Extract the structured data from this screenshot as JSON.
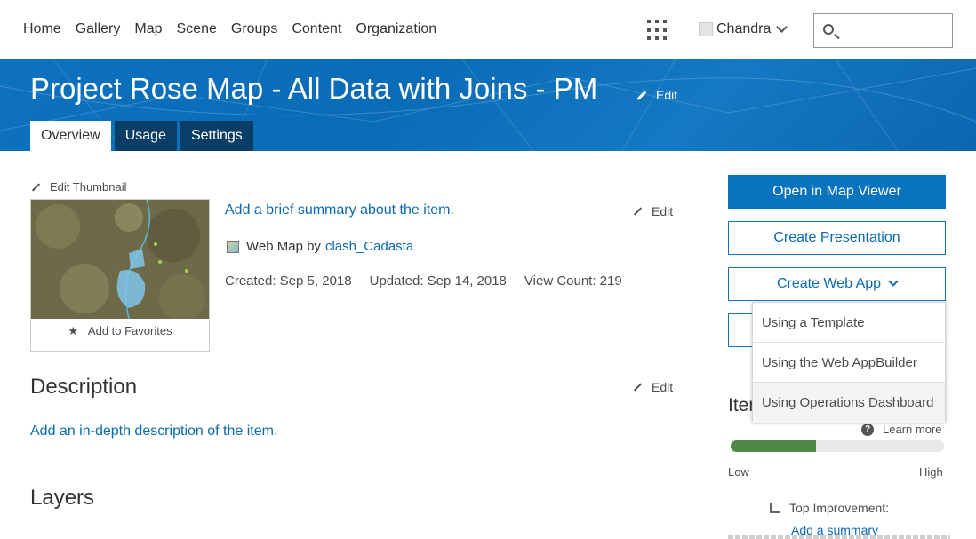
{
  "nav": {
    "links": [
      "Home",
      "Gallery",
      "Map",
      "Scene",
      "Groups",
      "Content",
      "Organization"
    ],
    "user_name": "Chandra",
    "search_placeholder": ""
  },
  "header": {
    "title": "Project Rose Map - All Data with Joins - PM",
    "edit_label": "Edit",
    "tabs": [
      {
        "label": "Overview",
        "active": true
      },
      {
        "label": "Usage",
        "active": false
      },
      {
        "label": "Settings",
        "active": false
      }
    ]
  },
  "item": {
    "edit_thumbnail_label": "Edit Thumbnail",
    "add_to_favorites_label": "Add to Favorites",
    "summary_link": "Add a brief summary about the item.",
    "summary_edit_label": "Edit",
    "type_label": "Web Map by",
    "owner": "clash_Cadasta",
    "created": "Created: Sep 5, 2018",
    "updated": "Updated: Sep 14, 2018",
    "view_count": "View Count: 219"
  },
  "description": {
    "heading": "Description",
    "edit_label": "Edit",
    "link": "Add an in-depth description of the item."
  },
  "layers": {
    "heading": "Layers"
  },
  "sidebar": {
    "open_map_viewer": "Open in Map Viewer",
    "create_presentation": "Create Presentation",
    "create_web_app": "Create Web App",
    "dropdown_items": [
      "Using a Template",
      "Using the Web AppBuilder",
      "Using Operations Dashboard"
    ],
    "details_heading_partial": "Item",
    "learn_more": "Learn more",
    "quality_score_fraction": 0.4,
    "low_label": "Low",
    "high_label": "High",
    "top_improvement_label": "Top Improvement:",
    "add_summary_link": "Add a summary"
  },
  "colors": {
    "accent": "#0a73c0",
    "banner": "#0e72bf",
    "tab_dark": "#0b3e66",
    "meter": "#4c8b45"
  }
}
